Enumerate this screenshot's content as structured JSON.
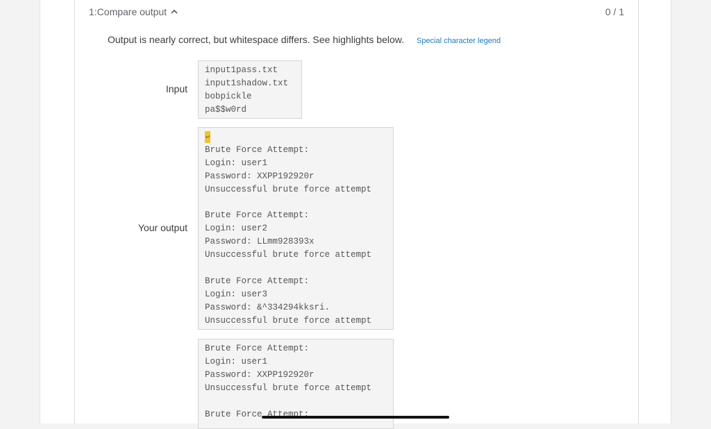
{
  "test": {
    "title": "1:Compare output",
    "score": "0 / 1",
    "message": "Output is nearly correct, but whitespace differs. See highlights below.",
    "legend_link": "Special character legend"
  },
  "input": {
    "label": "Input",
    "lines": [
      "input1pass.txt",
      "input1shadow.txt",
      "bobpickle",
      "pa$$w0rd"
    ]
  },
  "your_output": {
    "label": "Your output",
    "newline_marker": "↵",
    "lines": [
      "Brute Force Attempt:",
      "Login: user1",
      "Password: XXPP192920r",
      "Unsuccessful brute force attempt",
      "",
      "Brute Force Attempt:",
      "Login: user2",
      "Password: LLmm928393x",
      "Unsuccessful brute force attempt",
      "",
      "Brute Force Attempt:",
      "Login: user3",
      "Password: &^334294kksri.",
      "Unsuccessful brute force attempt"
    ]
  },
  "expected_output": {
    "lines": [
      "Brute Force Attempt:",
      "Login: user1",
      "Password: XXPP192920r",
      "Unsuccessful brute force attempt",
      "",
      "Brute Force Attempt:"
    ]
  },
  "colors": {
    "highlight": "#f1c232",
    "link": "#1f79b8"
  }
}
